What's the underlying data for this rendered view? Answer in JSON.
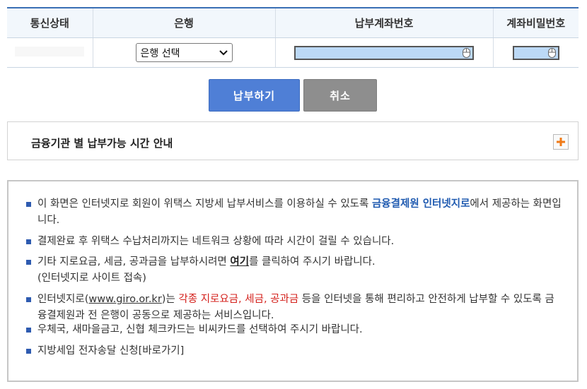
{
  "table": {
    "headers": [
      "통신상태",
      "은행",
      "납부계좌번호",
      "계좌비밀번호"
    ],
    "bank_select": {
      "value": "은행 선택"
    }
  },
  "buttons": {
    "pay": "납부하기",
    "cancel": "취소"
  },
  "time_info": {
    "title": "금융기관 별 납부가능 시간 안내"
  },
  "notice": {
    "item1": {
      "pre": "이 화면은 인터넷지로 회원이 위택스 지방세 납부서비스를 이용하실 수 있도록 ",
      "highlight": "금융결제원 인터넷지로",
      "post": "에서 제공하는 화면입니다."
    },
    "item2": "결제완료 후 위택스 수납처리까지는 네트워크 상황에 따라 시간이 걸릴 수 있습니다.",
    "item3": {
      "pre": "기타 지로요금, 세금, 공과금을 납부하시려면 ",
      "link": "여기",
      "post": "를 클릭하여 주시기 바랍니다.",
      "line2": "(인터넷지로 사이트 접속)"
    },
    "item4": {
      "pre": "인터넷지로(",
      "link": "www.giro.or.kr",
      "mid": ")는 ",
      "highlight": "각종 지로요금, 세금, 공과금",
      "post": " 등을 인터넷을 통해 편리하고 안전하게 납부할 수 있도록 금융결제원과 전 은행이 공동으로 제공하는 서비스입니다."
    },
    "item5": "우체국, 새마을금고, 신협 체크카드는 비씨카드를 선택하여 주시기 바랍니다.",
    "item6": "지방세입 전자송달 신청[바로가기]"
  },
  "colors": {
    "accent": "#3a6fb5",
    "pay_button": "#4f7fd6",
    "cancel_button": "#8e8e8e",
    "highlight_red": "#d4211c",
    "highlight_blue": "#1f5ab0"
  },
  "icons": [
    "chevron-down-icon",
    "mouse-icon",
    "plus-icon",
    "bullet-square-icon"
  ]
}
